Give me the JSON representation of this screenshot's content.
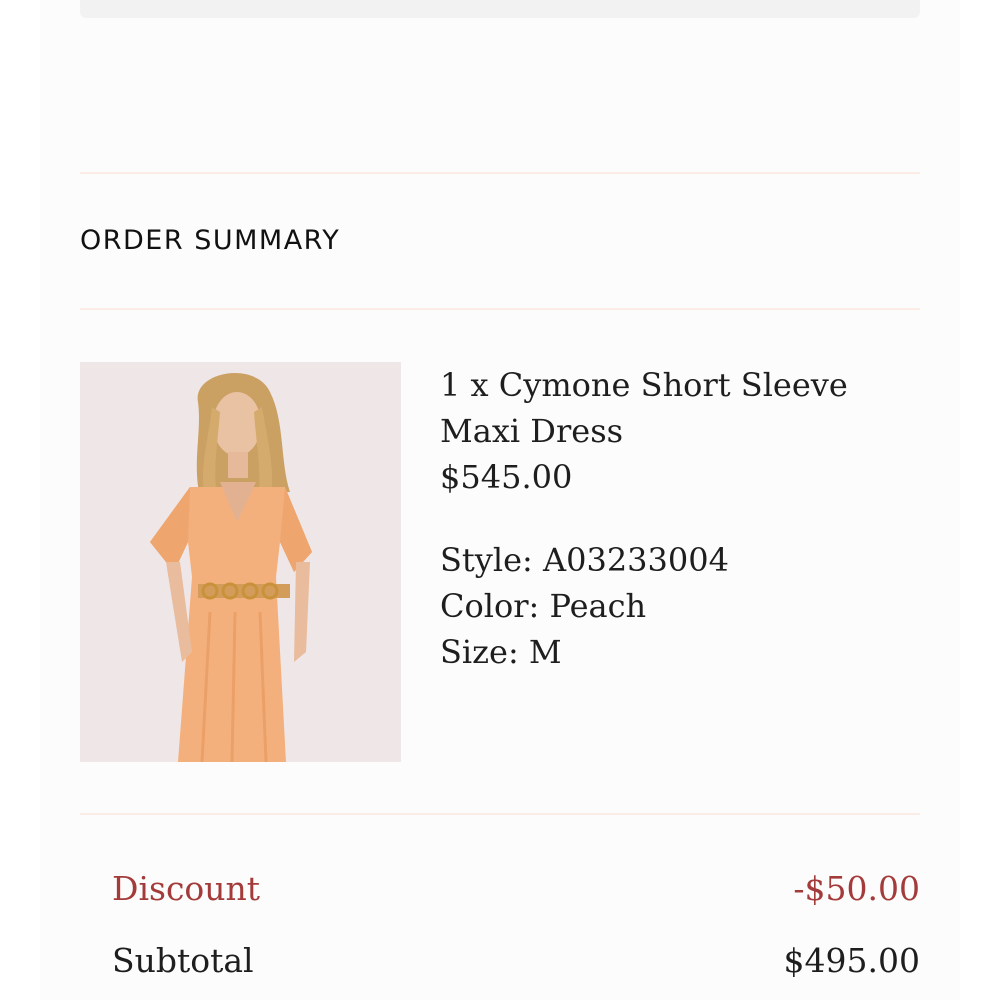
{
  "order_summary": {
    "title": "ORDER SUMMARY"
  },
  "item": {
    "title_line1": "1 x Cymone Short Sleeve",
    "title_line2": "Maxi Dress",
    "price": "$545.00",
    "style": "Style: A03233004",
    "color": "Color: Peach",
    "size": "Size: M",
    "image_icon": "product-photo-icon"
  },
  "totals": {
    "discount_label": "Discount",
    "discount_value": "-$50.00",
    "subtotal_label": "Subtotal",
    "subtotal_value": "$495.00"
  },
  "colors": {
    "discount": "#a43b3b",
    "text": "#1e1e1e",
    "divider": "#fbece6"
  }
}
